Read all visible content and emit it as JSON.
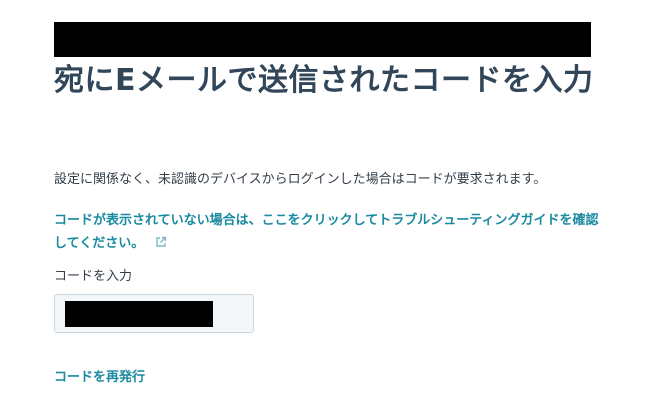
{
  "header": {
    "title": "宛にEメールで送信されたコードを入力"
  },
  "description": "設定に関係なく、未認識のデバイスからログインした場合はコードが要求されます。",
  "help_link": {
    "text": "コードが表示されていない場合は、ここをクリックしてトラブルシューティングガイドを確認してください。",
    "icon": "external-link-icon"
  },
  "code_field": {
    "label": "コードを入力",
    "value": ""
  },
  "resend": {
    "label": "コードを再発行"
  },
  "colors": {
    "heading": "#32465a",
    "link": "#1a8aa0",
    "input_bg": "#f4f7fa",
    "input_border": "#ccd6dd",
    "redaction": "#000000"
  }
}
